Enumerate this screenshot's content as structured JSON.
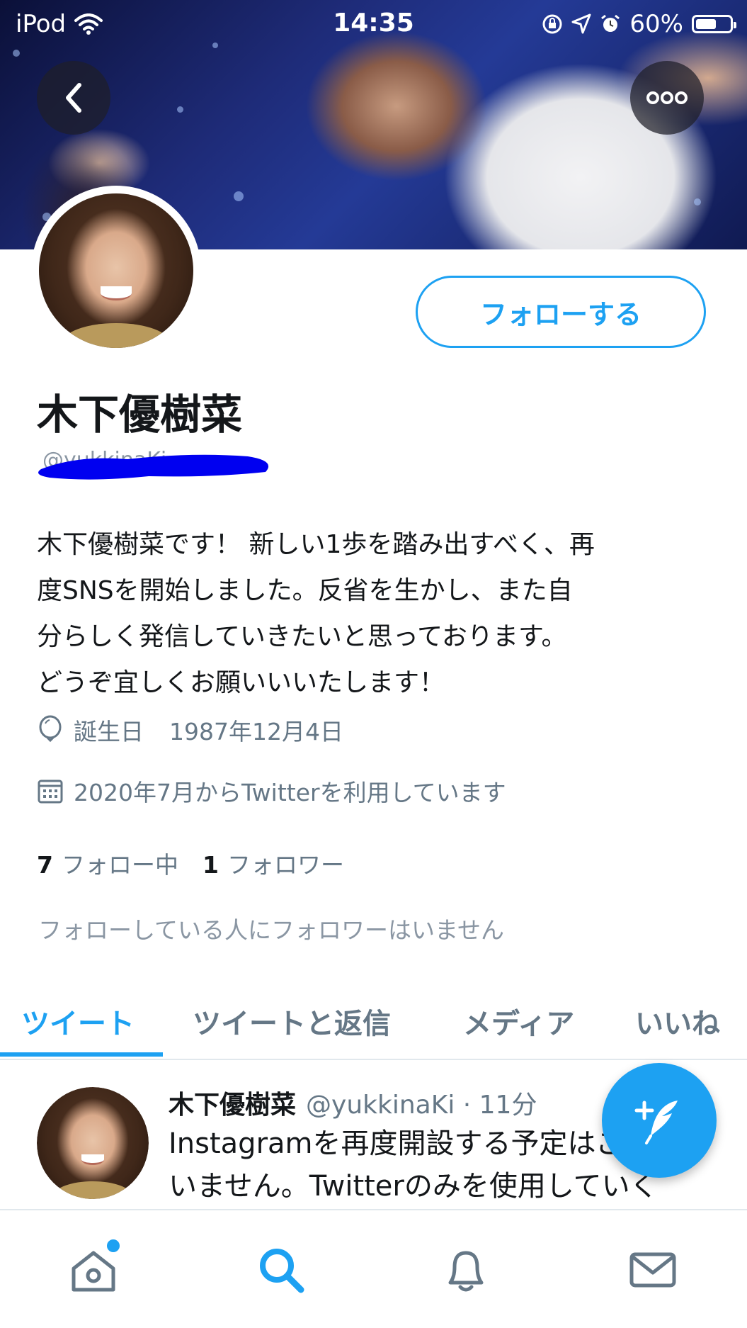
{
  "status_bar": {
    "carrier": "iPod",
    "time": "14:35",
    "battery": "60%",
    "battery_level": 0.6
  },
  "profile": {
    "name": "木下優樹菜",
    "handle": "@yukkinaKi",
    "follow_label": "フォローする",
    "bio": "木下優樹菜です！ 新しい1歩を踏み出すべく、再\n度SNSを開始しました。反省を生かし、また自\n分らしく発信していきたいと思っております。\nどうぞ宜しくお願いいいたします！",
    "birthday_label": "誕生日",
    "birthday": "1987年12月4日",
    "joined": "2020年7月からTwitterを利用しています",
    "following_count": "7",
    "following_label": "フォロー中",
    "followers_count": "1",
    "followers_label": "フォロワー",
    "no_followers_you_know": "フォローしている人にフォロワーはいません"
  },
  "tabs": [
    {
      "label": "ツイート",
      "active": true
    },
    {
      "label": "ツイートと返信",
      "active": false
    },
    {
      "label": "メディア",
      "active": false
    },
    {
      "label": "いいね",
      "active": false
    }
  ],
  "tweet": {
    "name": "木下優樹菜",
    "handle_time": "@yukkinaKi · 11分",
    "text": "Instagramを再度開設する予定はございま\nいません。Twitterのみを使用していく"
  },
  "icons": {
    "back": "chevron-left-icon",
    "more": "more-icon",
    "birthday": "balloon-icon",
    "joined": "calendar-icon",
    "compose": "compose-tweet-icon",
    "home": "home-icon",
    "search": "search-icon",
    "notifications": "bell-icon",
    "messages": "mail-icon"
  },
  "colors": {
    "accent": "#1da1f2",
    "text": "#14171a",
    "secondary": "#657786"
  }
}
